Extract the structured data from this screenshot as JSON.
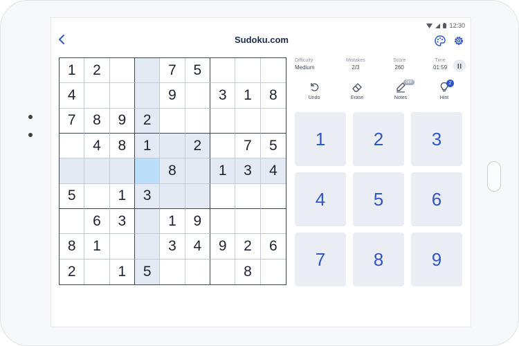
{
  "status": {
    "time": "12:30"
  },
  "header": {
    "title": "Sudoku.com"
  },
  "stats": {
    "difficulty_label": "Difficulty",
    "difficulty": "Medium",
    "mistakes_label": "Mistakes",
    "mistakes": "2/3",
    "score_label": "Score",
    "score": "260",
    "time_label": "Time",
    "time": "01:59"
  },
  "tools": {
    "undo": "Undo",
    "erase": "Erase",
    "notes": "Notes",
    "notes_state": "OFF",
    "hint": "Hint",
    "hint_count": "2"
  },
  "board": {
    "selected": {
      "row": 4,
      "col": 3
    },
    "rows": [
      [
        "1",
        "2",
        "",
        "",
        "7",
        "5",
        "",
        "",
        ""
      ],
      [
        "4",
        "",
        "",
        "",
        "9",
        "",
        "3",
        "1",
        "8"
      ],
      [
        "7",
        "8",
        "9",
        "2",
        "",
        "",
        "",
        "",
        ""
      ],
      [
        "",
        "4",
        "8",
        "1",
        "",
        "2",
        "",
        "7",
        "5"
      ],
      [
        "",
        "",
        "",
        "",
        "8",
        "",
        "1",
        "3",
        "4"
      ],
      [
        "5",
        "",
        "1",
        "3",
        "",
        "",
        "",
        "",
        ""
      ],
      [
        "",
        "6",
        "3",
        "",
        "1",
        "9",
        "",
        "",
        ""
      ],
      [
        "8",
        "1",
        "",
        "",
        "3",
        "4",
        "9",
        "2",
        "6"
      ],
      [
        "2",
        "",
        "1",
        "5",
        "",
        "",
        "",
        "8",
        ""
      ]
    ]
  },
  "numpad": [
    "1",
    "2",
    "3",
    "4",
    "5",
    "6",
    "7",
    "8",
    "9"
  ],
  "colors": {
    "accent": "#2f56c6",
    "highlight": "#e3eaf3",
    "selected": "#bbdefb",
    "key_bg": "#eaeef4"
  }
}
